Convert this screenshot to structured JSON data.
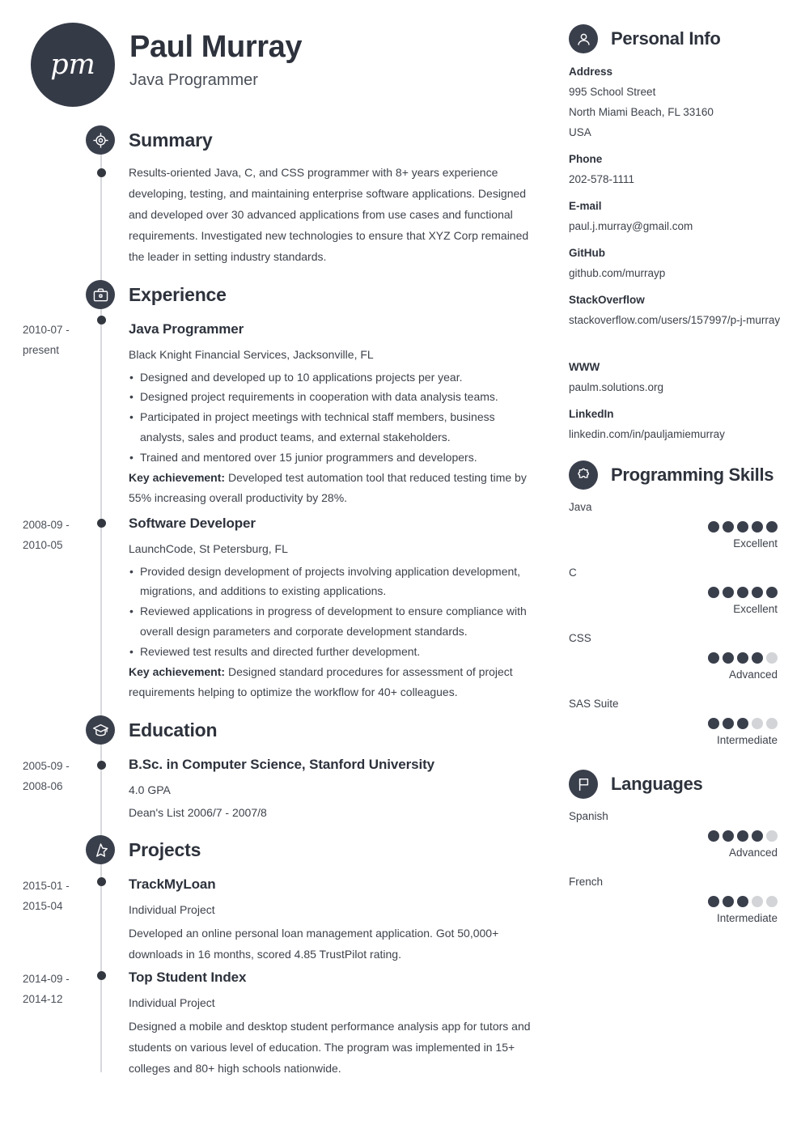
{
  "header": {
    "initials": "pm",
    "name": "Paul Murray",
    "job_title": "Java Programmer"
  },
  "colors": {
    "accent_dark": "#3a3f4c",
    "text": "#33373f",
    "dot_off": "#d2d4d7",
    "timeline": "#d6d8db"
  },
  "sections": {
    "summary": {
      "title": "Summary",
      "icon": "target-icon",
      "text": "Results-oriented Java, C, and CSS programmer with 8+ years experience developing, testing, and maintaining enterprise software applications. Designed and developed over 30 advanced applications from use cases and functional requirements. Investigated new technologies to ensure that XYZ Corp remained the leader in setting industry standards."
    },
    "experience": {
      "title": "Experience",
      "icon": "briefcase-icon",
      "entries": [
        {
          "date": "2010-07 - present",
          "title": "Java Programmer",
          "subtitle": "Black Knight Financial Services, Jacksonville, FL",
          "bullets": [
            "Designed and developed up to 10 applications projects per year.",
            "Designed project requirements in cooperation with data analysis teams.",
            "Participated in project meetings with technical staff members, business analysts, sales and product teams, and external stakeholders.",
            "Trained and mentored over 15 junior programmers and developers."
          ],
          "key_label": "Key achievement:",
          "key_text": " Developed test automation tool that reduced testing time by 55% increasing overall productivity by 28%."
        },
        {
          "date": "2008-09 - 2010-05",
          "title": "Software Developer",
          "subtitle": "LaunchCode, St Petersburg, FL",
          "bullets": [
            "Provided design development of projects involving application development, migrations, and additions to existing applications.",
            "Reviewed applications in progress of development to ensure compliance with overall design parameters and corporate development standards.",
            "Reviewed test results and directed further development."
          ],
          "key_label": "Key achievement:",
          "key_text": " Designed standard procedures for assessment of project requirements helping to optimize the workflow for 40+ colleagues."
        }
      ]
    },
    "education": {
      "title": "Education",
      "icon": "graduation-cap-icon",
      "entries": [
        {
          "date": "2005-09 - 2008-06",
          "title": "B.Sc. in Computer Science, Stanford University",
          "line1": "4.0 GPA",
          "line2": "Dean's List 2006/7 - 2007/8"
        }
      ]
    },
    "projects": {
      "title": "Projects",
      "icon": "star-icon",
      "entries": [
        {
          "date": "2015-01 - 2015-04",
          "title": "TrackMyLoan",
          "subtitle": "Individual Project",
          "text": "Developed an online personal loan management application. Got 50,000+ downloads in 16 months, scored 4.85 TrustPilot rating."
        },
        {
          "date": "2014-09 - 2014-12",
          "title": "Top Student Index",
          "subtitle": "Individual Project",
          "text": "Designed a mobile and desktop student performance analysis app for tutors and students on various level of education. The program was implemented in 15+ colleges and 80+ high schools nationwide."
        }
      ]
    },
    "personal_info": {
      "title": "Personal Info",
      "icon": "person-icon",
      "items": [
        {
          "label": "Address",
          "line1": "995 School Street",
          "line2": "North Miami Beach, FL 33160",
          "line3": "USA"
        },
        {
          "label": "Phone",
          "line1": "202-578-1111"
        },
        {
          "label": "E-mail",
          "line1": "paul.j.murray@gmail.com"
        },
        {
          "label": "GitHub",
          "line1": "github.com/murrayp"
        },
        {
          "label": "StackOverflow",
          "line1": "stackoverflow.com/users/157997/p-j-murray"
        },
        {
          "label": "WWW",
          "line1": "paulm.solutions.org"
        },
        {
          "label": "LinkedIn",
          "line1": "linkedin.com/in/pauljamiemurray"
        }
      ]
    },
    "programming_skills": {
      "title": "Programming Skills",
      "icon": "puzzle-icon",
      "max_dots": 5,
      "items": [
        {
          "name": "Java",
          "rating": 5,
          "level": "Excellent"
        },
        {
          "name": "C",
          "rating": 5,
          "level": "Excellent"
        },
        {
          "name": "CSS",
          "rating": 4,
          "level": "Advanced"
        },
        {
          "name": "SAS Suite",
          "rating": 3,
          "level": "Intermediate"
        }
      ]
    },
    "languages": {
      "title": "Languages",
      "icon": "flag-icon",
      "max_dots": 5,
      "items": [
        {
          "name": "Spanish",
          "rating": 4,
          "level": "Advanced"
        },
        {
          "name": "French",
          "rating": 3,
          "level": "Intermediate"
        }
      ]
    }
  }
}
